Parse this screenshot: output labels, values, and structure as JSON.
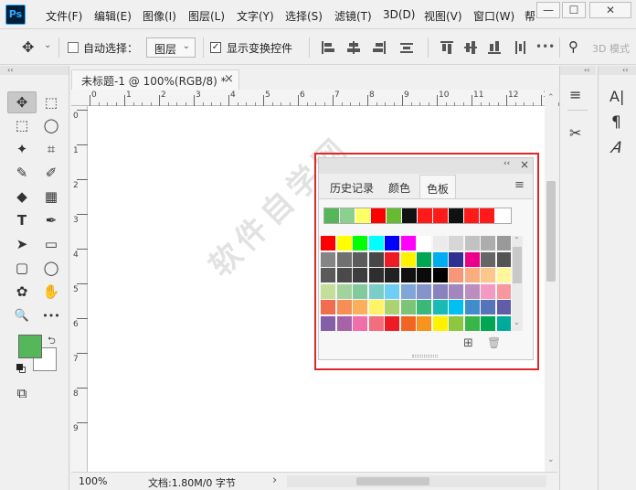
{
  "app": {
    "logo": "Ps"
  },
  "menus": [
    "文件(F)",
    "编辑(E)",
    "图像(I)",
    "图层(L)",
    "文字(Y)",
    "选择(S)",
    "滤镜(T)",
    "3D(D)",
    "视图(V)",
    "窗口(W)",
    "帮"
  ],
  "window_controls": {
    "minimize": "—",
    "maximize": "☐",
    "close": "✕"
  },
  "options": {
    "auto_select_label": "自动选择：",
    "layer_dropdown": "图层",
    "show_transform_label": "显示变换控件",
    "mode_3d": "3D 模式"
  },
  "document": {
    "tab_title": "未标题-1 @ 100%(RGB/8) *",
    "close_glyph": "×",
    "ruler_h_ticks": [
      "0",
      "2",
      "4",
      "6",
      "8",
      "10",
      "12",
      "14",
      "16",
      "18",
      "20",
      "22",
      "24",
      "26",
      "28",
      "30",
      "32",
      "34",
      "36",
      "38",
      "40",
      "42",
      "44",
      "46",
      "48",
      "50",
      "52",
      "54",
      "56",
      "58",
      "60",
      "62",
      "64",
      "66",
      "68",
      "70",
      "72",
      "74",
      "76",
      "78",
      "80",
      "82",
      "84",
      "86",
      "88",
      "90",
      "92",
      "94",
      "96",
      "98",
      "100",
      "102",
      "104",
      "106",
      "108",
      "110",
      "112",
      "114",
      "116",
      "118",
      "120"
    ],
    "ruler_h_labels": [
      "0",
      "1",
      "2",
      "3",
      "4",
      "5",
      "6",
      "7",
      "8",
      "9",
      "10",
      "11",
      "12",
      "1"
    ],
    "ruler_v_labels": [
      "0",
      "1",
      "2",
      "3",
      "4",
      "5",
      "6",
      "7",
      "8",
      "9"
    ]
  },
  "status": {
    "zoom": "100%",
    "doc_info": "文档:1.80M/0 字节",
    "arrow": "›"
  },
  "swatches_panel": {
    "collapse_glyph": "‹‹",
    "close_glyph": "×",
    "tabs": [
      "历史记录",
      "颜色",
      "色板"
    ],
    "active_tab": "色板",
    "menu_glyph": "≡",
    "recent_colors": [
      "#56b65a",
      "#8ccf8e",
      "#ffff66",
      "#ff0000",
      "#66bb33",
      "#111111",
      "#ff1a1a",
      "#ff1a1a",
      "#111111",
      "#ff1a1a",
      "#ff1a1a",
      "#ffffff"
    ],
    "grid": [
      [
        "#ff0000",
        "#ffff00",
        "#00ff00",
        "#00ffff",
        "#0000ff",
        "#ff00ff",
        "#ffffff",
        "#ebebeb",
        "#d6d6d6",
        "#c2c2c2",
        "#adadad",
        "#999999"
      ],
      [
        "#858585",
        "#707070",
        "#5c5c5c",
        "#474747",
        "#ed1c24",
        "#fff200",
        "#00a651",
        "#00aeef",
        "#2e3192",
        "#ec008c",
        "#666666",
        "#555555"
      ],
      [
        "#5a5a5a",
        "#4a4a4a",
        "#3d3d3d",
        "#2e2e2e",
        "#222222",
        "#111111",
        "#0a0a0a",
        "#000000",
        "#f7977a",
        "#f9ad81",
        "#fdc68a",
        "#fff79a"
      ],
      [
        "#c4df9b",
        "#a3d39c",
        "#82ca9d",
        "#7bcdc8",
        "#6ecff6",
        "#7ea7d8",
        "#8493ca",
        "#8882be",
        "#a187be",
        "#bc8dbf",
        "#f49ac2",
        "#f6989d"
      ],
      [
        "#f26c4f",
        "#f68e55",
        "#fbaf5c",
        "#fff467",
        "#acd372",
        "#7cc576",
        "#3bb878",
        "#1abbb4",
        "#00bff3",
        "#438ccb",
        "#5574b9",
        "#605ca8"
      ],
      [
        "#855fa8",
        "#a763a8",
        "#f06ea9",
        "#f26d7d",
        "#ed1c24",
        "#f26522",
        "#f7941d",
        "#fff200",
        "#8dc63f",
        "#39b54a",
        "#00a651",
        "#00a99d"
      ]
    ],
    "new_swatch_glyph": "⊞",
    "delete_glyph": "🗑"
  },
  "tools": [
    {
      "name": "move-tool",
      "glyph": "✥"
    },
    {
      "name": "artboard-tool",
      "glyph": "⬚"
    },
    {
      "name": "marquee-tool",
      "glyph": "⬚"
    },
    {
      "name": "lasso-tool",
      "glyph": "◯"
    },
    {
      "name": "magic-wand-tool",
      "glyph": "✦"
    },
    {
      "name": "crop-tool",
      "glyph": "⌗"
    },
    {
      "name": "eyedropper-tool",
      "glyph": "✎"
    },
    {
      "name": "brush-tool",
      "glyph": "✐"
    },
    {
      "name": "eraser-tool",
      "glyph": "◆"
    },
    {
      "name": "gradient-tool",
      "glyph": "▦"
    },
    {
      "name": "type-tool",
      "glyph": "T"
    },
    {
      "name": "pen-tool",
      "glyph": "✒"
    },
    {
      "name": "path-select-tool",
      "glyph": "➤"
    },
    {
      "name": "rectangle-tool",
      "glyph": "▭"
    },
    {
      "name": "rounded-rect-tool",
      "glyph": "▢"
    },
    {
      "name": "ellipse-tool",
      "glyph": "◯"
    },
    {
      "name": "custom-shape-tool",
      "glyph": "✿"
    },
    {
      "name": "hand-tool",
      "glyph": "✋"
    },
    {
      "name": "zoom-tool",
      "glyph": "🔍"
    },
    {
      "name": "more-tools",
      "glyph": "•••"
    }
  ],
  "colors": {
    "foreground": "#56b65a",
    "background": "#ffffff",
    "selection_frame": "#e0262a"
  },
  "right_panels": {
    "collapse_glyph": "‹‹",
    "panel1_icons": [
      "≡",
      "✂"
    ],
    "panel2_icons": [
      "A|",
      "¶",
      "𝐴"
    ]
  },
  "watermark": "软件自学网"
}
